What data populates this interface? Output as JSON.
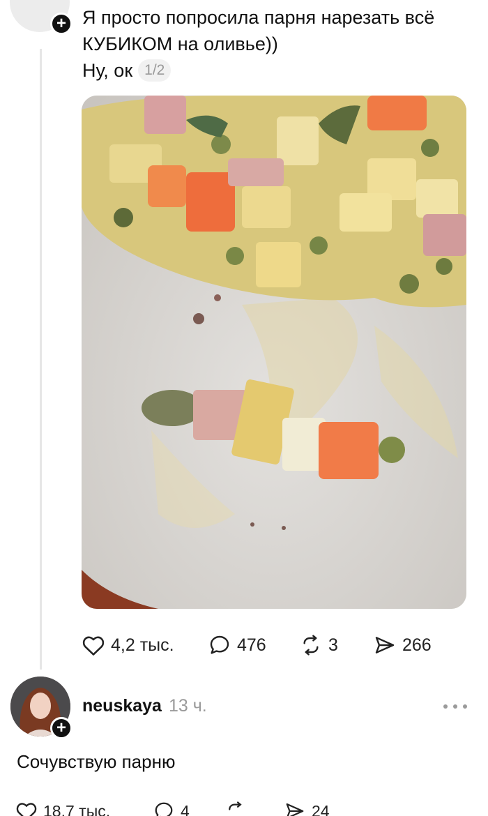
{
  "post": {
    "text_line1": "Я просто попросила парня нарезать всё",
    "text_line2": "КУБИКОМ на оливье))",
    "text_line3": "Ну, ок",
    "media_counter": "1/2",
    "actions": {
      "likes": "4,2 тыс.",
      "comments": "476",
      "reposts": "3",
      "shares": "266"
    }
  },
  "comment": {
    "username": "neuskaya",
    "time": "13 ч.",
    "text": "Сочувствую парню",
    "actions": {
      "likes": "18,7 тыс.",
      "comments": "4",
      "reposts": "",
      "shares": "24"
    }
  },
  "icons": {
    "like": "heart-icon",
    "comment": "speech-bubble-icon",
    "repost": "repost-arrows-icon",
    "share": "paper-plane-icon",
    "more": "more-dots-icon",
    "follow": "plus-icon"
  },
  "colors": {
    "text": "#111111",
    "muted": "#9a9a9a",
    "thread_line": "#e6e6e6",
    "badge": "#111111"
  }
}
